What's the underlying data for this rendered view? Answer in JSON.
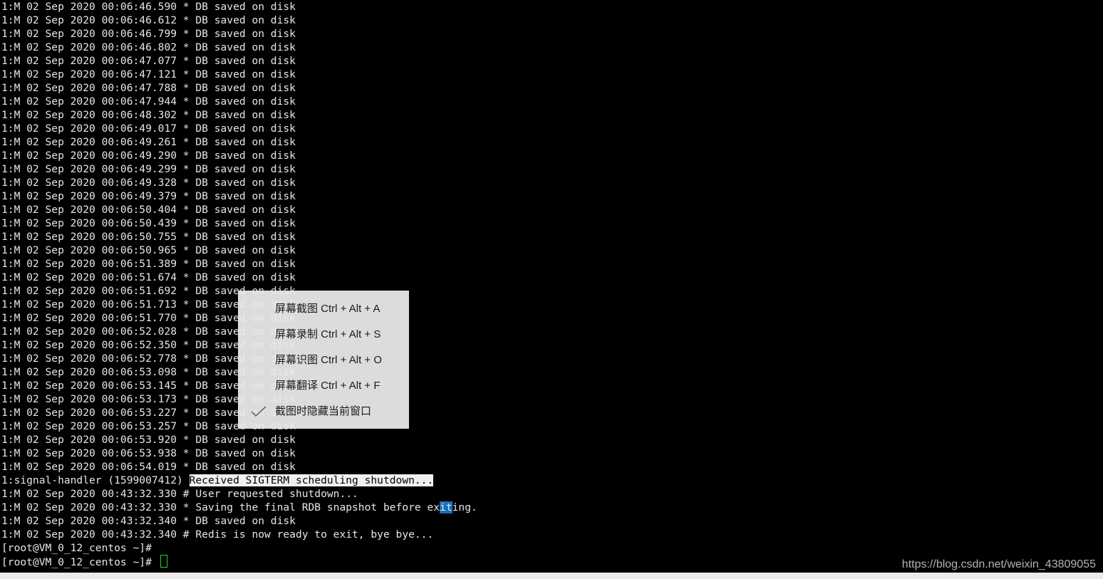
{
  "terminal": {
    "log_lines": [
      "1:M 02 Sep 2020 00:06:46.590 * DB saved on disk",
      "1:M 02 Sep 2020 00:06:46.612 * DB saved on disk",
      "1:M 02 Sep 2020 00:06:46.799 * DB saved on disk",
      "1:M 02 Sep 2020 00:06:46.802 * DB saved on disk",
      "1:M 02 Sep 2020 00:06:47.077 * DB saved on disk",
      "1:M 02 Sep 2020 00:06:47.121 * DB saved on disk",
      "1:M 02 Sep 2020 00:06:47.788 * DB saved on disk",
      "1:M 02 Sep 2020 00:06:47.944 * DB saved on disk",
      "1:M 02 Sep 2020 00:06:48.302 * DB saved on disk",
      "1:M 02 Sep 2020 00:06:49.017 * DB saved on disk",
      "1:M 02 Sep 2020 00:06:49.261 * DB saved on disk",
      "1:M 02 Sep 2020 00:06:49.290 * DB saved on disk",
      "1:M 02 Sep 2020 00:06:49.299 * DB saved on disk",
      "1:M 02 Sep 2020 00:06:49.328 * DB saved on disk",
      "1:M 02 Sep 2020 00:06:49.379 * DB saved on disk",
      "1:M 02 Sep 2020 00:06:50.404 * DB saved on disk",
      "1:M 02 Sep 2020 00:06:50.439 * DB saved on disk",
      "1:M 02 Sep 2020 00:06:50.755 * DB saved on disk",
      "1:M 02 Sep 2020 00:06:50.965 * DB saved on disk",
      "1:M 02 Sep 2020 00:06:51.389 * DB saved on disk",
      "1:M 02 Sep 2020 00:06:51.674 * DB saved on disk",
      "1:M 02 Sep 2020 00:06:51.692 * DB saved on disk",
      "1:M 02 Sep 2020 00:06:51.713 * DB saved on disk",
      "1:M 02 Sep 2020 00:06:51.770 * DB saved on disk",
      "1:M 02 Sep 2020 00:06:52.028 * DB saved on disk",
      "1:M 02 Sep 2020 00:06:52.350 * DB saved on disk",
      "1:M 02 Sep 2020 00:06:52.778 * DB saved on disk",
      "1:M 02 Sep 2020 00:06:53.098 * DB saved on disk",
      "1:M 02 Sep 2020 00:06:53.145 * DB saved on disk",
      "1:M 02 Sep 2020 00:06:53.173 * DB saved on disk",
      "1:M 02 Sep 2020 00:06:53.227 * DB saved on disk",
      "1:M 02 Sep 2020 00:06:53.257 * DB saved on disk",
      "1:M 02 Sep 2020 00:06:53.920 * DB saved on disk",
      "1:M 02 Sep 2020 00:06:53.938 * DB saved on disk",
      "1:M 02 Sep 2020 00:06:54.019 * DB saved on disk"
    ],
    "signal_line": {
      "prefix": "1:signal-handler (1599007412) ",
      "highlighted": "Received SIGTERM scheduling shutdown..."
    },
    "shutdown_line": "1:M 02 Sep 2020 00:43:32.330 # User requested shutdown...",
    "saving_line": {
      "before": "1:M 02 Sep 2020 00:43:32.330 * Saving the final RDB snapshot before ex",
      "selected": "it",
      "after": "ing."
    },
    "after_lines": [
      "1:M 02 Sep 2020 00:43:32.340 * DB saved on disk",
      "1:M 02 Sep 2020 00:43:32.340 # Redis is now ready to exit, bye bye..."
    ],
    "prompt_1": "[root@VM_0_12_centos ~]#",
    "prompt_2": "[root@VM_0_12_centos ~]# "
  },
  "context_menu": {
    "items": [
      {
        "label": "屏幕截图 Ctrl + Alt + A",
        "checked": false
      },
      {
        "label": "屏幕录制 Ctrl + Alt + S",
        "checked": false
      },
      {
        "label": "屏幕识图 Ctrl + Alt + O",
        "checked": false
      },
      {
        "label": "屏幕翻译 Ctrl + Alt + F",
        "checked": false
      },
      {
        "label": "截图时隐藏当前窗口",
        "checked": true
      }
    ]
  },
  "watermark": "https://blog.csdn.net/weixin_43809055",
  "colors": {
    "terminal_bg": "#000000",
    "terminal_text": "#e6e6e6",
    "cursor": "#22dd22",
    "selection": "#1c6fb8",
    "menu_bg": "#eaeaea"
  }
}
